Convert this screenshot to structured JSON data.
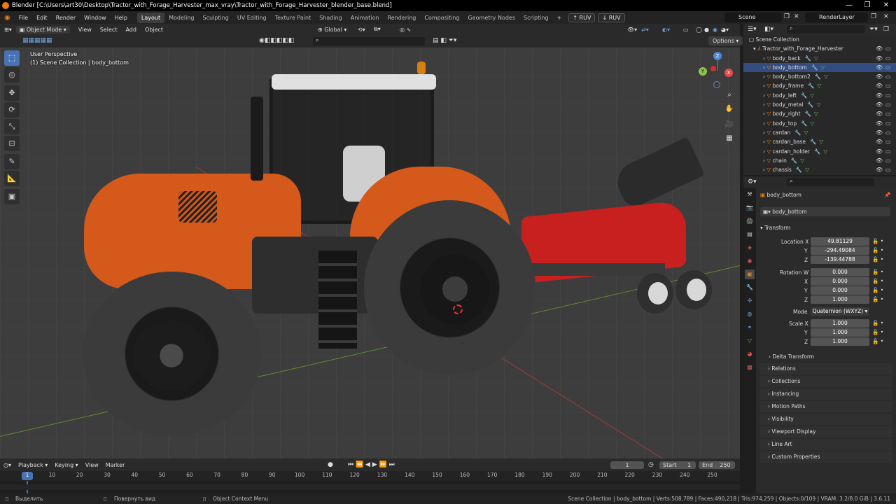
{
  "window": {
    "title": "Blender [C:\\Users\\art30\\Desktop\\Tractor_with_Forage_Harvester_max_vray\\Tractor_with_Forage_Harvester_blender_base.blend]",
    "min": "—",
    "max": "❐",
    "close": "✕"
  },
  "menu": {
    "items": [
      "File",
      "Edit",
      "Render",
      "Window",
      "Help"
    ]
  },
  "workspaces": [
    "Layout",
    "Modeling",
    "Sculpting",
    "UV Editing",
    "Texture Paint",
    "Shading",
    "Animation",
    "Rendering",
    "Compositing",
    "Geometry Nodes",
    "Scripting"
  ],
  "ruv": [
    "RUV",
    "RUV"
  ],
  "scene": {
    "name": "Scene",
    "layer": "RenderLayer"
  },
  "viewport": {
    "mode": "Object Mode",
    "menus": [
      "View",
      "Select",
      "Add",
      "Object"
    ],
    "transform": "Global",
    "overlay_title": "User Perspective",
    "overlay_sub": "(1) Scene Collection | body_bottom",
    "options": "Options",
    "gizmo": {
      "x": "X",
      "y": "Y",
      "z": "Z"
    }
  },
  "outliner": {
    "root": "Scene Collection",
    "collection": "Tractor_with_Forage_Harvester",
    "items": [
      "body_back",
      "body_bottom",
      "body_bottom2",
      "body_frame",
      "body_left",
      "body_metal",
      "body_right",
      "body_top",
      "cardan",
      "cardan_base",
      "cardan_holder",
      "chain",
      "chassis"
    ]
  },
  "properties": {
    "object_name": "body_bottom",
    "data_name": "body_bottom",
    "transform_label": "Transform",
    "location_label": "Location X",
    "location": [
      "49.81129",
      "-294.49084",
      "-139.44788"
    ],
    "rotation_label": "Rotation W",
    "rotation": [
      "0.000",
      "0.000",
      "0.000",
      "1.000"
    ],
    "mode_label": "Mode",
    "mode": "Quaternion (WXYZ)",
    "scale_label": "Scale X",
    "scale": [
      "1.000",
      "1.000",
      "1.000"
    ],
    "axis_labels": [
      "X",
      "Y",
      "Z"
    ],
    "delta": "Delta Transform",
    "sections": [
      "Relations",
      "Collections",
      "Instancing",
      "Motion Paths",
      "Visibility",
      "Viewport Display",
      "Line Art",
      "Custom Properties"
    ]
  },
  "timeline": {
    "menus": [
      "Playback",
      "Keying",
      "View",
      "Marker"
    ],
    "current_frame": "1",
    "start_label": "Start",
    "start": "1",
    "end_label": "End",
    "end": "250",
    "ticks": [
      "1",
      "10",
      "20",
      "30",
      "40",
      "50",
      "60",
      "70",
      "80",
      "90",
      "100",
      "110",
      "120",
      "130",
      "140",
      "150",
      "160",
      "170",
      "180",
      "190",
      "200",
      "210",
      "220",
      "230",
      "240",
      "250"
    ]
  },
  "status": {
    "left1": "Выделить",
    "left2": "Повернуть вид",
    "left3": "Object Context Menu",
    "right": "Scene Collection | body_bottom | Verts:508,789 | Faces:490,218 | Tris:974,259 | Objects:0/109 | VRAM: 3.2/8.0 GiB | 3.6.11"
  },
  "colors": {
    "accent": "#4772b3",
    "tractor": "#d4591a",
    "harvester": "#c8201f",
    "tire": "#2a2a2a"
  }
}
